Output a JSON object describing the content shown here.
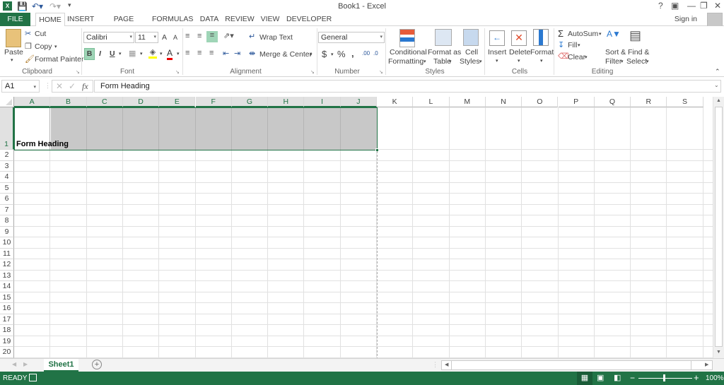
{
  "window": {
    "title": "Book1 - Excel",
    "sign_in": "Sign in"
  },
  "quick_access": {
    "save": "save-icon",
    "undo": "undo-icon",
    "redo": "redo-icon"
  },
  "tabs": [
    {
      "label": "FILE"
    },
    {
      "label": "HOME",
      "active": true
    },
    {
      "label": "INSERT"
    },
    {
      "label": "PAGE LAYOUT"
    },
    {
      "label": "FORMULAS"
    },
    {
      "label": "DATA"
    },
    {
      "label": "REVIEW"
    },
    {
      "label": "VIEW"
    },
    {
      "label": "DEVELOPER"
    }
  ],
  "ribbon": {
    "clipboard": {
      "paste": "Paste",
      "cut": "Cut",
      "copy": "Copy",
      "format_painter": "Format Painter",
      "label": "Clipboard"
    },
    "font": {
      "name": "Calibri",
      "size": "11",
      "bold": "B",
      "italic": "I",
      "underline": "U",
      "grow": "A",
      "shrink": "A",
      "color_a": "A",
      "label": "Font"
    },
    "alignment": {
      "wrap": "Wrap Text",
      "merge": "Merge & Center",
      "label": "Alignment"
    },
    "number": {
      "format": "General",
      "currency": "$",
      "percent": "%",
      "comma": ",",
      "label": "Number"
    },
    "styles": {
      "conditional_1": "Conditional",
      "conditional_2": "Formatting",
      "table_1": "Format as",
      "table_2": "Table",
      "cell_1": "Cell",
      "cell_2": "Styles",
      "label": "Styles"
    },
    "cells": {
      "insert": "Insert",
      "delete": "Delete",
      "format": "Format",
      "label": "Cells"
    },
    "editing": {
      "autosum": "AutoSum",
      "fill": "Fill",
      "clear": "Clear",
      "sort_1": "Sort &",
      "sort_2": "Filter",
      "find_1": "Find &",
      "find_2": "Select",
      "label": "Editing"
    }
  },
  "formula_bar": {
    "name_box": "A1",
    "fx": "fx",
    "value": "Form Heading"
  },
  "grid": {
    "columns": [
      "A",
      "B",
      "C",
      "D",
      "E",
      "F",
      "G",
      "H",
      "I",
      "J",
      "K",
      "L",
      "M",
      "N",
      "O",
      "P",
      "Q",
      "R",
      "S"
    ],
    "rows": [
      "1",
      "2",
      "3",
      "4",
      "5",
      "6",
      "7",
      "8",
      "9",
      "10",
      "11",
      "12",
      "13",
      "14",
      "15",
      "16",
      "17",
      "18",
      "19",
      "20"
    ],
    "cells": {
      "A1": "Form Heading"
    },
    "selection": "A1:J1",
    "fill_color": "#c8c8c8"
  },
  "sheets": [
    {
      "label": "Sheet1",
      "active": true
    }
  ],
  "status": {
    "mode": "READY",
    "zoom": "100%",
    "zoom_level": 1.0
  },
  "colors": {
    "accent": "#217346"
  }
}
